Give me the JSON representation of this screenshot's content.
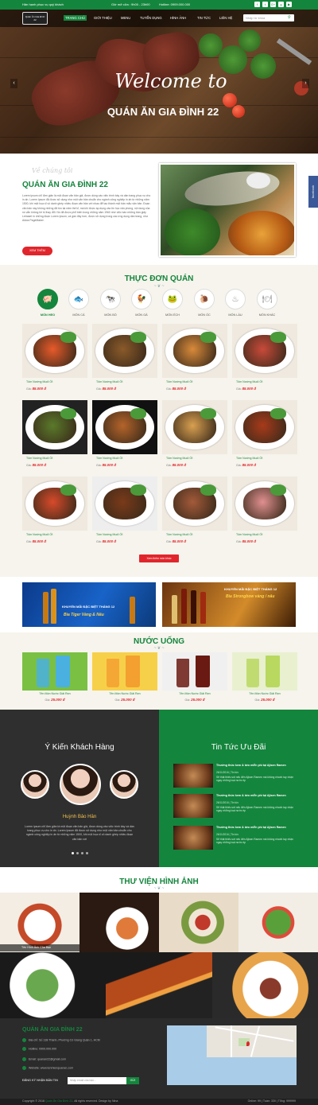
{
  "topbar": {
    "greeting": "Hân hạnh phục vụ quý khách",
    "hours": "Giờ mở cửa : 9h00 - 23h00",
    "hotline": "Hotline: 0909.000.000",
    "social": [
      "f",
      "t",
      "G+",
      "g",
      "▶"
    ]
  },
  "nav": {
    "logo_line1": "Quán Ăn Gia Đình",
    "logo_line2": "22",
    "items": [
      "TRANG CHỦ",
      "GIỚI THIỆU",
      "MENU",
      "TUYỂN DỤNG",
      "HÌNH ẢNH",
      "TIN TỨC",
      "LIÊN HỆ"
    ],
    "search_placeholder": "Nhập từ khóa"
  },
  "hero": {
    "welcome": "Welcome to",
    "title": "QUÁN ĂN GIA ĐÌNH 22",
    "prev": "‹",
    "next": "›"
  },
  "about": {
    "script": "Về chúng tôi",
    "title": "QUÁN ĂN GIA ĐÌNH 22",
    "text": "Lorem ipsum chỉ đơn giản là một đoạn văn bản giả, được dùng vào việc trình bày và dàn trang phục vụ cho in ấn. Lorem Ipsum đã được sử dụng như một văn bản chuẩn cho ngành công nghiệp in ấn từ những năm 1500, khi một họa sĩ vô danh ghép nhiều đoạn văn bản với nhau để tạo thành một bản mẫu văn bản. Đoạn văn bản này không những đã tồn tại năm thế kỉ, mà khi được áp dụng vào tin học văn phòng, nội dung của nó vẫn không hề bị thay đổi. Nó đã được phổ biến trong những năm 1960 nhờ việc bán những bản giấy Letraset in những đoạn Lorem Ipsum, và gần đây hơn, được sử dụng trong các ứng dụng dàn trang, như Aldus PageMaker.",
    "button": "XEM THÊM",
    "facebook": "facebook"
  },
  "menu": {
    "title": "THỰC ĐƠN QUÁN",
    "categories": [
      {
        "label": "MÓN HEO",
        "icon": "pig-icon",
        "glyph": "🐖"
      },
      {
        "label": "MÓN CÁ",
        "icon": "fish-icon",
        "glyph": "🐟"
      },
      {
        "label": "MÓN BÒ",
        "icon": "cow-icon",
        "glyph": "🐄"
      },
      {
        "label": "MÓN GÀ",
        "icon": "chicken-icon",
        "glyph": "🐓"
      },
      {
        "label": "MÓN ẾCH",
        "icon": "frog-icon",
        "glyph": "🐸"
      },
      {
        "label": "MÓN ỐC",
        "icon": "snail-icon",
        "glyph": "🐌"
      },
      {
        "label": "MÓN LẨU",
        "icon": "hotpot-icon",
        "glyph": "♨"
      },
      {
        "label": "MÓN KHÁC",
        "icon": "dish-icon",
        "glyph": "🍽"
      }
    ],
    "dishes": [
      {
        "name": "Tôm Nướng Muối Ớt",
        "price_label": "Giá:",
        "price": "85.000 đ"
      },
      {
        "name": "Tôm Nướng Muối Ớt",
        "price_label": "Giá:",
        "price": "85.000 đ"
      },
      {
        "name": "Tôm Nướng Muối Ớt",
        "price_label": "Giá:",
        "price": "85.000 đ"
      },
      {
        "name": "Tôm Nướng Muối Ớt",
        "price_label": "Giá:",
        "price": "85.000 đ"
      },
      {
        "name": "Tôm Nướng Muối Ớt",
        "price_label": "Giá:",
        "price": "85.000 đ"
      },
      {
        "name": "Tôm Nướng Muối Ớt",
        "price_label": "Giá:",
        "price": "85.000 đ"
      },
      {
        "name": "Tôm Nướng Muối Ớt",
        "price_label": "Giá:",
        "price": "85.000 đ"
      },
      {
        "name": "Tôm Nướng Muối Ớt",
        "price_label": "Giá:",
        "price": "85.000 đ"
      },
      {
        "name": "Tôm Nướng Muối Ớt",
        "price_label": "Giá:",
        "price": "85.000 đ"
      },
      {
        "name": "Tôm Nướng Muối Ớt",
        "price_label": "Giá:",
        "price": "85.000 đ"
      },
      {
        "name": "Tôm Nướng Muối Ớt",
        "price_label": "Giá:",
        "price": "85.000 đ"
      },
      {
        "name": "Tôm Nướng Muối Ớt",
        "price_label": "Giá:",
        "price": "85.000 đ"
      }
    ],
    "more": "Xem thêm món khác"
  },
  "banners": {
    "b1_line1": "KHUYẾN MÃI ĐẶC BIỆT THÁNG 12",
    "b1_line2": "Bia Tiger Vàng & Nâu",
    "b2_line1": "KHUYẾN MÃI ĐẶC BIỆT THÁNG 12",
    "b2_line2": "Bia Strongbow vàng / nâu"
  },
  "drinks": {
    "title": "NƯỚC UỐNG",
    "items": [
      {
        "name": "Tên Món Nước Giải Rẹn",
        "price_label": "Giá:",
        "price": "25.000 đ"
      },
      {
        "name": "Tên Món Nước Giải Rẹn",
        "price_label": "Giá:",
        "price": "25.000 đ"
      },
      {
        "name": "Tên Món Nước Giải Rẹn",
        "price_label": "Giá:",
        "price": "25.000 đ"
      },
      {
        "name": "Tên Món Nước Giải Rẹn",
        "price_label": "Giá:",
        "price": "25.000 đ"
      }
    ]
  },
  "testimonials": {
    "title": "Ý Kiến Khách Hàng",
    "name": "Huỳnh Bảo Hân",
    "text": "Lorem ipsum chỉ đơn giản là một đoạn văn bản giả, được dùng vào việc trình bày và dàn trang phục vụ cho in ấn. Lorem Ipsum đã được sử dụng như một văn bản chuẩn cho ngành công nghiệp in ấn từ những năm 1500, khi một họa sĩ vô danh ghép nhiều đoạn văn bản với"
  },
  "news": {
    "title": "Tin Tức Ưu Đãi",
    "items": [
      {
        "title": "Thưởng thức kem & bèo miễn phí tại Ajisen Ramen",
        "date": "26/11/2016 | Tin tức",
        "text": "Sẽ thật thiếu sót nếu đến Ajisen Ramen mà không nhanh tay nhận ngay những loại nước ép"
      },
      {
        "title": "Thưởng thức kem & bèo miễn phí tại Ajisen Ramen",
        "date": "26/11/2016 | Tin tức",
        "text": "Sẽ thật thiếu sót nếu đến Ajisen Ramen mà không nhanh tay nhận ngay những loại nước ép"
      },
      {
        "title": "Thưởng thức kem & bèo miễn phí tại Ajisen Ramen",
        "date": "26/11/2016 | Tin tức",
        "text": "Sẽ thật thiếu sót nếu đến Ajisen Ramen mà không nhanh tay nhận ngay những loại nước ép"
      }
    ]
  },
  "gallery": {
    "title": "THƯ VIỆN HÌNH ẢNH",
    "caption": "Tên Hình Ảnh Của Bạn"
  },
  "footer": {
    "name": "QUÁN ĂN GIA ĐÌNH 22",
    "address": "Địa chỉ: Số 138 Thành, Phường Cô Giang Quận 1, HCM",
    "hotline": "Hotline: 0909.000.000",
    "email": "Email: quanan22@gmail.com",
    "website": "Website: www.tenmienquanan.com",
    "subscribe_label": "ĐĂNG KÝ NHẬN BẢN TIN",
    "subscribe_placeholder": "Nhập email của bạn...",
    "subscribe_button": "GỬI",
    "copyright_prefix": "Copyright © 2018 ",
    "copyright_brand": "Quán Ăn Gia Đình 22",
    "copyright_suffix": ". All rights reserved. Design by Nina",
    "stats": "Online: 99  |  Tuần: 330  |  Tổng: 999999"
  },
  "colors": {
    "brand_green": "#14853d",
    "accent_red": "#e0262c",
    "dark": "#2f2f2f"
  }
}
